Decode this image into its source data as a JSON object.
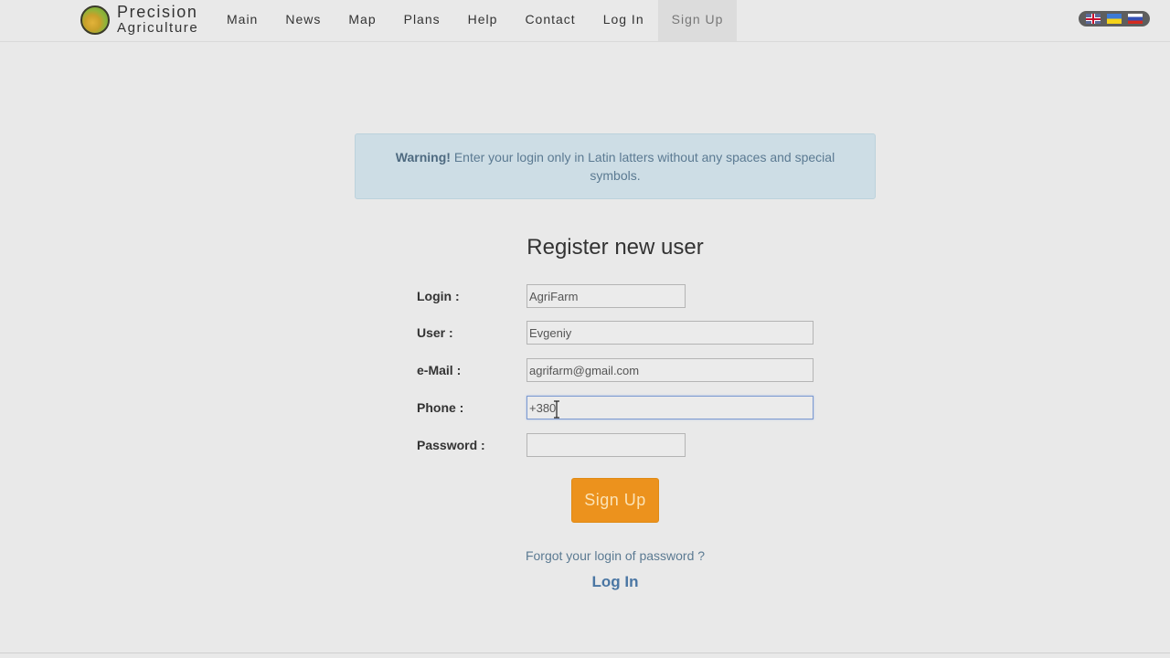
{
  "brand": {
    "line1": "Precision",
    "line2": "Agriculture"
  },
  "nav": {
    "items": [
      {
        "label": "Main"
      },
      {
        "label": "News"
      },
      {
        "label": "Map"
      },
      {
        "label": "Plans"
      },
      {
        "label": "Help"
      },
      {
        "label": "Contact"
      },
      {
        "label": "Log In"
      },
      {
        "label": "Sign Up",
        "active": true
      }
    ]
  },
  "languages": [
    {
      "icon": "uk-flag-icon",
      "name": "English"
    },
    {
      "icon": "ukraine-flag-icon",
      "name": "Ukrainian"
    },
    {
      "icon": "russia-flag-icon",
      "name": "Russian"
    }
  ],
  "alert": {
    "strong": "Warning!",
    "text": " Enter your login only in Latin latters without any spaces and special symbols."
  },
  "form": {
    "title": "Register new user",
    "fields": {
      "login": {
        "label": "Login :",
        "value": "AgriFarm"
      },
      "user": {
        "label": "User :",
        "value": "Evgeniy"
      },
      "email": {
        "label": "e-Mail :",
        "value": "agrifarm@gmail.com"
      },
      "phone": {
        "label": "Phone :",
        "value": "+380"
      },
      "password": {
        "label": "Password :",
        "value": ""
      }
    },
    "submit_label": "Sign Up",
    "forgot_label": "Forgot your login of password ?",
    "login_label": "Log In"
  },
  "colors": {
    "accent": "#ec921d",
    "link": "#4a76a3",
    "alert_bg": "#cddde5"
  }
}
